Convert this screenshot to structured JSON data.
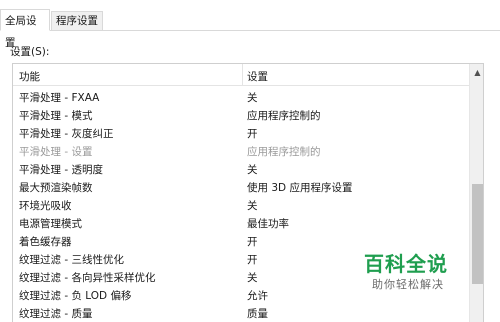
{
  "tabs": [
    {
      "label": "全局设置",
      "active": true
    },
    {
      "label": "程序设置",
      "active": false
    }
  ],
  "settings_label": "设置(S):",
  "columns": {
    "feature": "功能",
    "setting": "设置"
  },
  "rows": [
    {
      "feature": "平滑处理 - FXAA",
      "value": "关",
      "disabled": false
    },
    {
      "feature": "平滑处理 - 模式",
      "value": "应用程序控制的",
      "disabled": false
    },
    {
      "feature": "平滑处理 - 灰度纠正",
      "value": "开",
      "disabled": false
    },
    {
      "feature": "平滑处理 - 设置",
      "value": "应用程序控制的",
      "disabled": true
    },
    {
      "feature": "平滑处理 - 透明度",
      "value": "关",
      "disabled": false
    },
    {
      "feature": "最大预渲染帧数",
      "value": "使用 3D 应用程序设置",
      "disabled": false
    },
    {
      "feature": "环境光吸收",
      "value": "关",
      "disabled": false
    },
    {
      "feature": "电源管理模式",
      "value": "最佳功率",
      "disabled": false
    },
    {
      "feature": "着色缓存器",
      "value": "开",
      "disabled": false
    },
    {
      "feature": "纹理过滤 - 三线性优化",
      "value": "开",
      "disabled": false
    },
    {
      "feature": "纹理过滤 - 各向异性采样优化",
      "value": "关",
      "disabled": false
    },
    {
      "feature": "纹理过滤 - 负 LOD 偏移",
      "value": "允许",
      "disabled": false
    },
    {
      "feature": "纹理过滤 - 质量",
      "value": "质量",
      "disabled": false
    }
  ],
  "watermark": {
    "title": "百科全说",
    "subtitle": "助你轻松解决"
  },
  "colors": {
    "watermark_green": "#1f9e4f",
    "disabled_text": "#9a9a9a"
  }
}
